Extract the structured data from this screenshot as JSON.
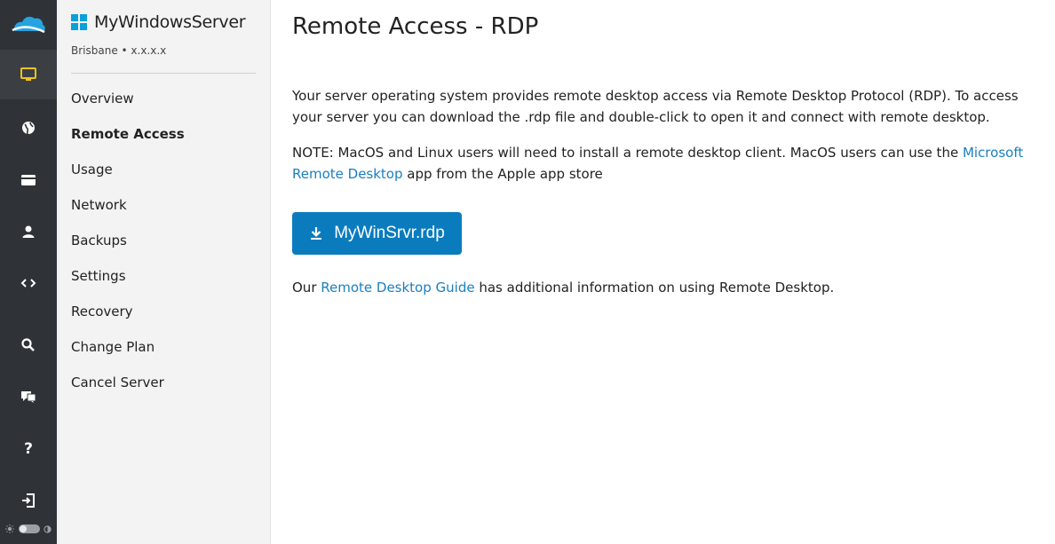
{
  "rail": {
    "items": [
      {
        "icon": "monitor-icon",
        "active": true,
        "color": "#f0c419"
      },
      {
        "icon": "globe-icon"
      },
      {
        "icon": "credit-card-icon"
      },
      {
        "icon": "user-icon"
      },
      {
        "icon": "code-icon"
      },
      {
        "icon": "search-icon"
      },
      {
        "icon": "chat-icon"
      },
      {
        "icon": "help-icon",
        "glyph": "?"
      },
      {
        "icon": "logout-icon"
      }
    ]
  },
  "server": {
    "name": "MyWindowsServer",
    "location": "Brisbane • x.x.x.x"
  },
  "nav": {
    "items": [
      {
        "label": "Overview"
      },
      {
        "label": "Remote Access",
        "active": true
      },
      {
        "label": "Usage"
      },
      {
        "label": "Network"
      },
      {
        "label": "Backups"
      },
      {
        "label": "Settings"
      },
      {
        "label": "Recovery"
      },
      {
        "label": "Change Plan"
      },
      {
        "label": "Cancel Server"
      }
    ]
  },
  "main": {
    "title": "Remote Access - RDP",
    "intro": "Your server operating system provides remote desktop access via Remote Desktop Protocol (RDP). To access your server you can download the .rdp file and double-click to open it and connect with remote desktop.",
    "note_prefix": "NOTE: MacOS and Linux users will need to install a remote desktop client. MacOS users can use the ",
    "note_link": "Microsoft Remote Desktop",
    "note_suffix": " app from the Apple app store",
    "download_label": "MyWinSrvr.rdp",
    "guide_prefix": "Our ",
    "guide_link": "Remote Desktop Guide",
    "guide_suffix": " has additional information on using Remote Desktop."
  },
  "colors": {
    "accent": "#0a7cbe",
    "link": "#1a7fc1",
    "rail_bg": "#2f3337",
    "active_icon": "#f0c419"
  }
}
